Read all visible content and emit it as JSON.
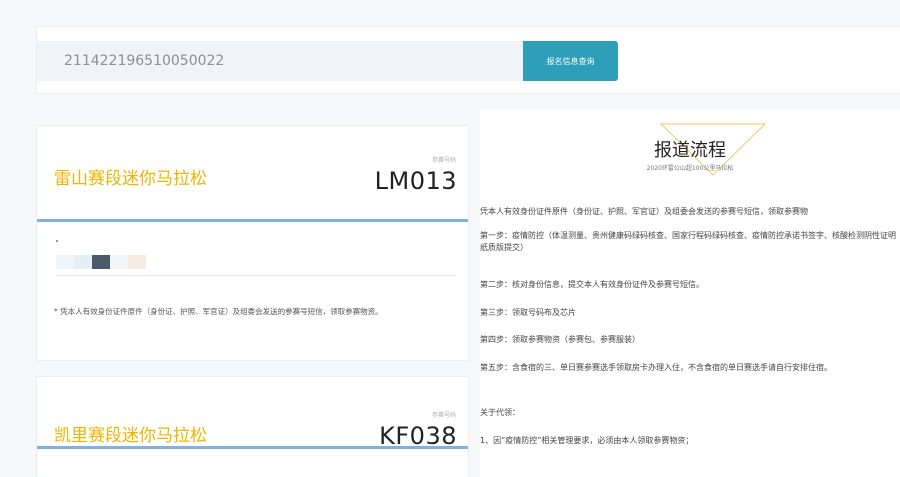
{
  "search": {
    "value": "211422196510050022",
    "button_label": "报名信息查询"
  },
  "cards": [
    {
      "race_name": "雷山赛段迷你马拉松",
      "bib_label": "参赛号码",
      "bib_number": "LM013",
      "note": "* 凭本人有效身份证件原件（身份证、护照、军官证）及组委会发送的参赛号短信，领取参赛物资。",
      "swatch_colors": [
        "#eef6fa",
        "#e4eef3",
        "#4a5a68",
        "#f3f6f8",
        "#f6ebe0"
      ]
    },
    {
      "race_name": "凯里赛段迷你马拉松",
      "bib_label": "参赛号码",
      "bib_number": "KF038"
    }
  ],
  "flow": {
    "title": "报道流程",
    "subtitle": "2020环雷公山超100公里马拉松",
    "intro": "凭本人有效身份证件原件（身份证、护照、军官证）及组委会发送的参赛号短信，领取参赛物",
    "step1": "第一步：疫情防控（体温测量、贵州健康码绿码核查、国家行程码绿码核查、疫情防控承诺书签字、核酸检测阴性证明纸质版提交）",
    "step2": "第二步：核对身份信息，提交本人有效身份证件及参赛号短信。",
    "step3": "第三步：领取号码布及芯片",
    "step4": "第四步：领取参赛物资（参赛包、参赛服装）",
    "step5": "第五步：含食宿的三、单日赛参赛选手领取房卡办理入住，不含食宿的单日赛选手请自行安排住宿。",
    "proxy_title": "关于代领：",
    "proxy_1": "1、因“疫情防控”相关管理要求，必须由本人领取参赛物资；"
  },
  "colors": {
    "accent": "#2d9fb8",
    "race_name": "#f0b400",
    "card_divider": "#7fb1e6",
    "triangle": "#f5c66b"
  }
}
